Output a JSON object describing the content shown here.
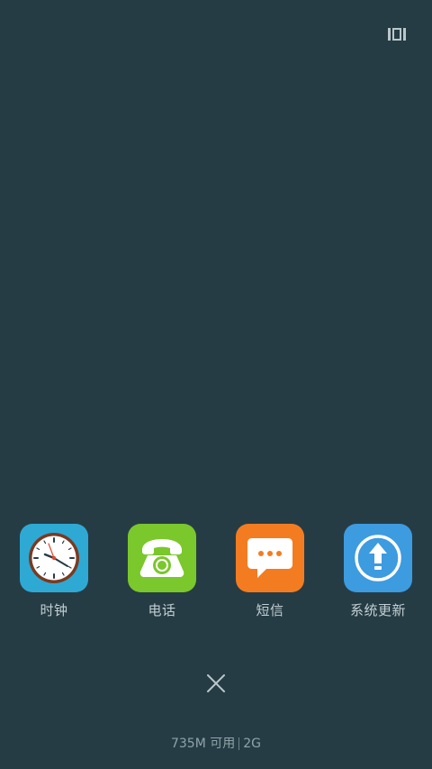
{
  "screen": {
    "background_color": "#263c45"
  },
  "top_right": {
    "icon": "layout-toggle-icon"
  },
  "apps": [
    {
      "label": "时钟",
      "icon": "clock-icon",
      "tile_color": "#2ea9d4"
    },
    {
      "label": "电话",
      "icon": "phone-icon",
      "tile_color": "#7ac82b"
    },
    {
      "label": "短信",
      "icon": "message-icon",
      "tile_color": "#f47c20"
    },
    {
      "label": "系统更新",
      "icon": "update-icon",
      "tile_color": "#3d9be0"
    }
  ],
  "close_control": {
    "icon": "close-icon"
  },
  "memory_status": {
    "available": "735M 可用",
    "total": "2G"
  }
}
